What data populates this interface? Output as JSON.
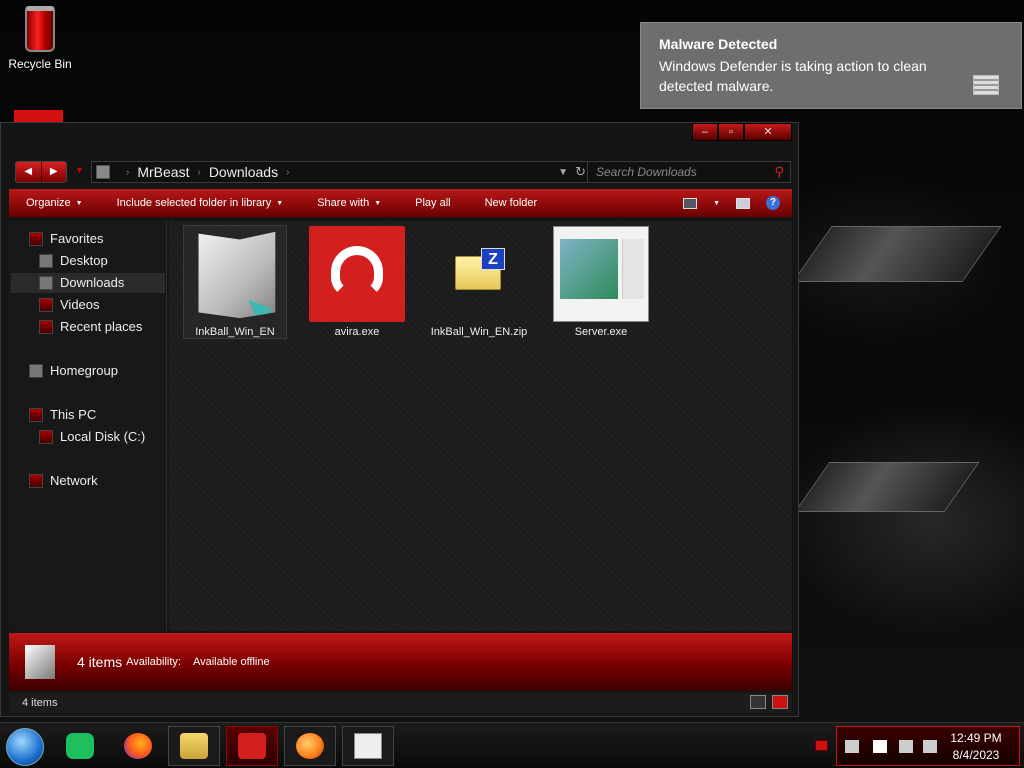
{
  "desktop": {
    "recycle_bin_label": "Recycle Bin"
  },
  "notification": {
    "title": "Malware Detected",
    "body": "Windows Defender is taking action to clean detected malware.",
    "icon": "defender-wall-icon"
  },
  "window": {
    "caption_buttons": [
      "minimize",
      "maximize",
      "close"
    ],
    "address": {
      "crumbs": [
        "MrBeast",
        "Downloads"
      ],
      "separator": "›"
    },
    "search": {
      "placeholder": "Search Downloads"
    },
    "toolbar": {
      "organize": "Organize",
      "include": "Include selected folder in library",
      "share": "Share with",
      "play_all": "Play all",
      "new_folder": "New folder"
    },
    "nav": {
      "favorites": "Favorites",
      "desktop": "Desktop",
      "downloads": "Downloads",
      "videos": "Videos",
      "recent": "Recent places",
      "homegroup": "Homegroup",
      "this_pc": "This PC",
      "local_disk": "Local Disk (C:)",
      "network": "Network",
      "selected": "Downloads"
    },
    "files": [
      {
        "name": "InkBall_Win_EN",
        "icon": "folder-shortcut-icon",
        "selected": true
      },
      {
        "name": "avira.exe",
        "icon": "avira-icon",
        "selected": false
      },
      {
        "name": "InkBall_Win_EN.zip",
        "icon": "zip-folder-icon",
        "selected": false
      },
      {
        "name": "Server.exe",
        "icon": "app-window-icon",
        "selected": false
      }
    ],
    "details": {
      "count": "4 items",
      "availability_label": "Availability:",
      "availability_value": "Available offline"
    },
    "status": {
      "count": "4 items"
    }
  },
  "taskbar": {
    "apps": [
      "start-orb",
      "notes",
      "firefox",
      "file-explorer",
      "avira",
      "paint",
      "server"
    ],
    "active": "avira",
    "clock": {
      "time": "12:49 PM",
      "date": "8/4/2023"
    }
  },
  "colors": {
    "accent": "#d41010",
    "toolbar": "#b81818",
    "notification_bg": "#6e6e6e"
  }
}
